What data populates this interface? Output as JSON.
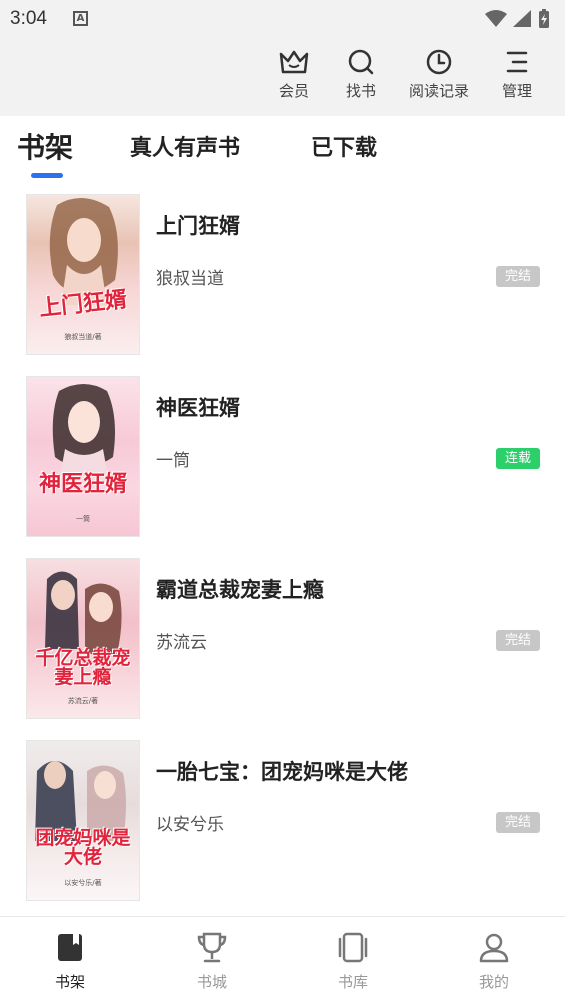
{
  "status_bar": {
    "time": "3:04",
    "notification_letter": "A"
  },
  "top_actions": [
    {
      "label": "会员",
      "icon": "crown-icon"
    },
    {
      "label": "找书",
      "icon": "search-icon"
    },
    {
      "label": "阅读记录",
      "icon": "clock-icon"
    },
    {
      "label": "管理",
      "icon": "menu-icon"
    }
  ],
  "tabs": [
    {
      "label": "书架",
      "active": true
    },
    {
      "label": "真人有声书",
      "active": false
    },
    {
      "label": "已下载",
      "active": false
    }
  ],
  "books": [
    {
      "title": "上门狂婿",
      "author": "狼叔当道",
      "status": "完结",
      "status_color": "#c7c7c7",
      "cover_title": "上门狂婿",
      "cover_author": "狼叔当道/著"
    },
    {
      "title": "神医狂婿",
      "author": "一筒",
      "status": "连载",
      "status_color": "#2ccf6a",
      "cover_title": "神医狂婿",
      "cover_author": "一筒"
    },
    {
      "title": "霸道总裁宠妻上瘾",
      "author": "苏流云",
      "status": "完结",
      "status_color": "#c7c7c7",
      "cover_title": "千亿总裁宠妻上瘾",
      "cover_author": "苏流云/著"
    },
    {
      "title": "一胎七宝：团宠妈咪是大佬",
      "author": "以安兮乐",
      "status": "完结",
      "status_color": "#c7c7c7",
      "cover_title": "团宠妈咪是大佬",
      "cover_author": "以安兮乐/著"
    }
  ],
  "bottom_nav": [
    {
      "label": "书架",
      "icon": "bookshelf-icon",
      "active": true
    },
    {
      "label": "书城",
      "icon": "trophy-icon",
      "active": false
    },
    {
      "label": "书库",
      "icon": "book-library-icon",
      "active": false
    },
    {
      "label": "我的",
      "icon": "user-icon",
      "active": false
    }
  ],
  "colors": {
    "accent": "#2e6ff0",
    "serial_badge": "#2ccf6a",
    "finished_badge": "#c7c7c7"
  }
}
